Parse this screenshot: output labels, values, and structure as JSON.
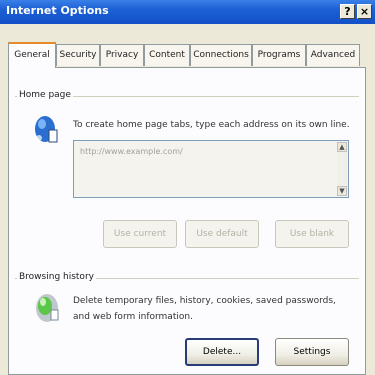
{
  "window": {
    "title": "Internet Options",
    "help_label": "?",
    "close_label": "×"
  },
  "tabs": [
    {
      "label": "General"
    },
    {
      "label": "Security"
    },
    {
      "label": "Privacy"
    },
    {
      "label": "Content"
    },
    {
      "label": "Connections"
    },
    {
      "label": "Programs"
    },
    {
      "label": "Advanced"
    }
  ],
  "home_page": {
    "group_label": "Home page",
    "description": "To create home page tabs, type each address on its own line.",
    "url_value": "http://www.example.com/",
    "icon": "home-page-icon",
    "buttons": {
      "use_current": "Use current",
      "use_default": "Use default",
      "use_blank": "Use blank"
    }
  },
  "browsing_history": {
    "group_label": "Browsing history",
    "description_line1": "Delete temporary files, history, cookies, saved passwords,",
    "description_line2": "and web form information.",
    "icon": "browsing-history-icon",
    "buttons": {
      "delete": "Delete...",
      "settings": "Settings"
    }
  },
  "colors": {
    "titlebar": "#1c5fd4",
    "active_tab_accent": "#e68b2c",
    "panel_bg": "#fcfcfe",
    "dialog_bg": "#ece9d8"
  }
}
